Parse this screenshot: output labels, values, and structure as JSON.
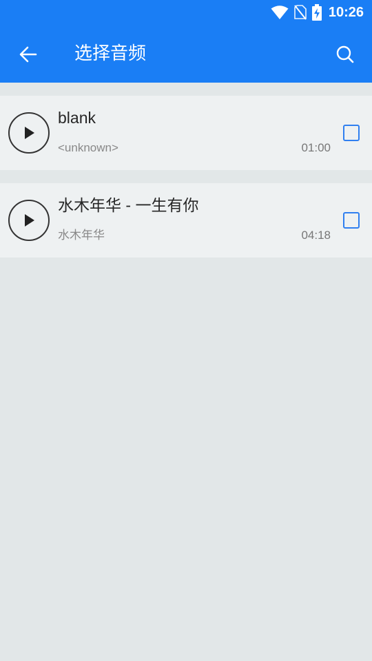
{
  "status_bar": {
    "time": "10:26",
    "icons": [
      "wifi-icon",
      "no-sim-icon",
      "battery-charging-icon"
    ]
  },
  "app_bar": {
    "title": "选择音频",
    "back_icon": "arrow-back-icon",
    "search_icon": "search-icon",
    "color": "#1a7ef5"
  },
  "audio_list": [
    {
      "title": "blank",
      "artist": "<unknown>",
      "duration": "01:00",
      "checked": false
    },
    {
      "title": "水木年华 - 一生有你",
      "artist": "水木年华",
      "duration": "04:18",
      "checked": false
    }
  ],
  "colors": {
    "accent": "#1a7ef5",
    "checkbox": "#2f7ff0",
    "background": "#e2e7e8",
    "row_background": "#eef1f2"
  }
}
